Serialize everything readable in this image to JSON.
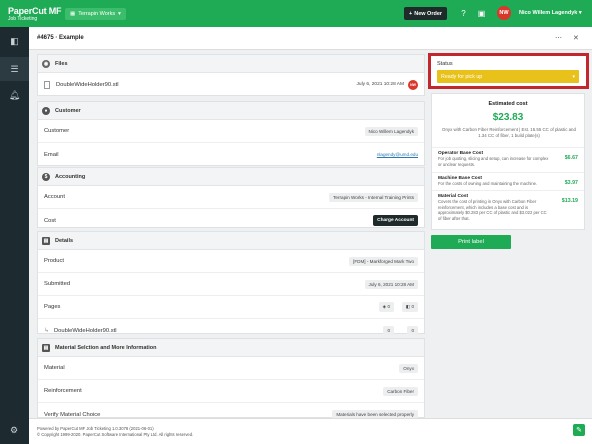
{
  "topbar": {
    "logo_line1": "PaperCut MF",
    "logo_line2": "Job Ticketing",
    "org": "Terrapin Works",
    "new_order": "New Order",
    "user_initials": "NW",
    "user_name": "Nico Willem Lagendyk"
  },
  "subheader": {
    "order_id": "#4675",
    "order_sep": "·",
    "order_name": "Example"
  },
  "files": {
    "heading": "Files",
    "name": "DoubleWideHolder90.stl",
    "date": "July 6, 2021 10:28 AM",
    "owner_initials": "NW"
  },
  "customer": {
    "heading": "Customer",
    "rows": [
      {
        "label": "Customer",
        "value": "Nico Willem Lagendyk"
      },
      {
        "label": "Email",
        "value": "nlagendy@umd.edu"
      }
    ]
  },
  "accounting": {
    "heading": "Accounting",
    "account_label": "Account",
    "account_value": "Terrapin Works - Internal Training Prints",
    "cost_label": "Cost",
    "charge_button": "Charge Account"
  },
  "details": {
    "heading": "Details",
    "product_label": "Product",
    "product_value": "[FDM] - Markforged Mark Two",
    "submitted_label": "Submitted",
    "submitted_value": "July 6, 2021 10:28 AM",
    "pages_label": "Pages",
    "pages_a": "0",
    "pages_b": "0",
    "file_name": "DoubleWideHolder90.stl",
    "file_a": "0",
    "file_b": "0"
  },
  "material": {
    "heading": "Material Selction and More Information",
    "rows": [
      {
        "label": "Material",
        "value": "Onyx"
      },
      {
        "label": "Reinforcement",
        "value": "Carbon Fiber"
      },
      {
        "label": "Verify Material Choice",
        "value": "Materials have been selected properly"
      }
    ]
  },
  "status": {
    "label": "Status",
    "value": "Ready for pick up",
    "color": "#e8c21b"
  },
  "estimate": {
    "title": "Estimated cost",
    "price": "$23.83",
    "description": "Onyx with Carbon Fiber Reinforcement | Est. 15.55 CC of plastic and 1.34 CC of fiber, 1 build plate(s)",
    "costs": [
      {
        "name": "Operator Base Cost",
        "text": "For job quoting, slicing and setup, can increase for complex or unclear requests.",
        "value": "$6.67"
      },
      {
        "name": "Machine Base Cost",
        "text": "For the costs of owning and maintaining the machine.",
        "value": "$3.97"
      },
      {
        "name": "Material Cost",
        "text": "Covers the cost of printing in Onyx with Carbon Fiber reinforcement, which includes a base cost and is approximately $0.283 per CC of plastic and $3.022 per CC of fiber after that.",
        "value": "$13.19"
      }
    ]
  },
  "print_label": "Print label",
  "footer": {
    "line1": "Powered by PaperCut MF Job Ticketing 1.0.3078 (2021-06-01)",
    "line2": "© Copyright 1999-2020. PaperCut Software International Pty Ltd. All rights reserved."
  },
  "colors": {
    "brand_green": "#1faa55",
    "sidebar": "#1d2a30",
    "highlight_red": "#c1272d"
  }
}
